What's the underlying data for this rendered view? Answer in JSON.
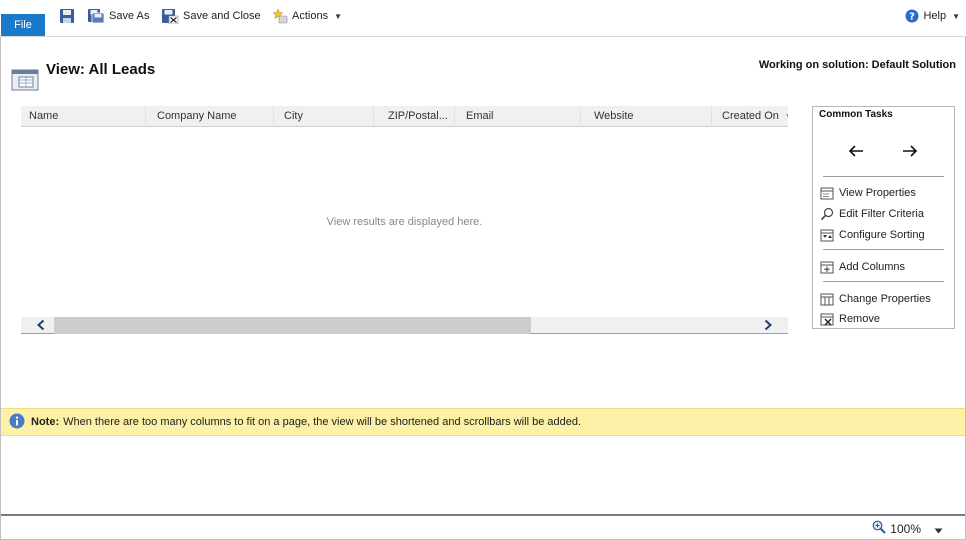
{
  "ribbon": {
    "file_label": "File",
    "save_as_label": "Save As",
    "save_close_label": "Save and Close",
    "actions_label": "Actions",
    "help_label": "Help"
  },
  "header": {
    "title": "View: All Leads",
    "solution": "Working on solution: Default Solution"
  },
  "grid": {
    "columns": [
      "Name",
      "Company Name",
      "City",
      "ZIP/Postal...",
      "Email",
      "Website",
      "Created On"
    ],
    "empty_text": "View results are displayed here."
  },
  "common_tasks": {
    "title": "Common Tasks",
    "items": [
      {
        "label": "View Properties",
        "icon": "view-properties-icon"
      },
      {
        "label": "Edit Filter Criteria",
        "icon": "filter-icon"
      },
      {
        "label": "Configure Sorting",
        "icon": "sorting-icon"
      },
      {
        "label": "Add Columns",
        "icon": "add-columns-icon"
      },
      {
        "label": "Change Properties",
        "icon": "change-properties-icon"
      },
      {
        "label": "Remove",
        "icon": "remove-icon"
      }
    ]
  },
  "note": {
    "label": "Note:",
    "text": "When there are too many columns to fit on a page, the view will be shortened and scrollbars will be added."
  },
  "status": {
    "zoom": "100%"
  },
  "colors": {
    "file_tab": "#1979ca",
    "note_bg": "#fcf1a6",
    "grid_header": "#f0f0f0"
  }
}
